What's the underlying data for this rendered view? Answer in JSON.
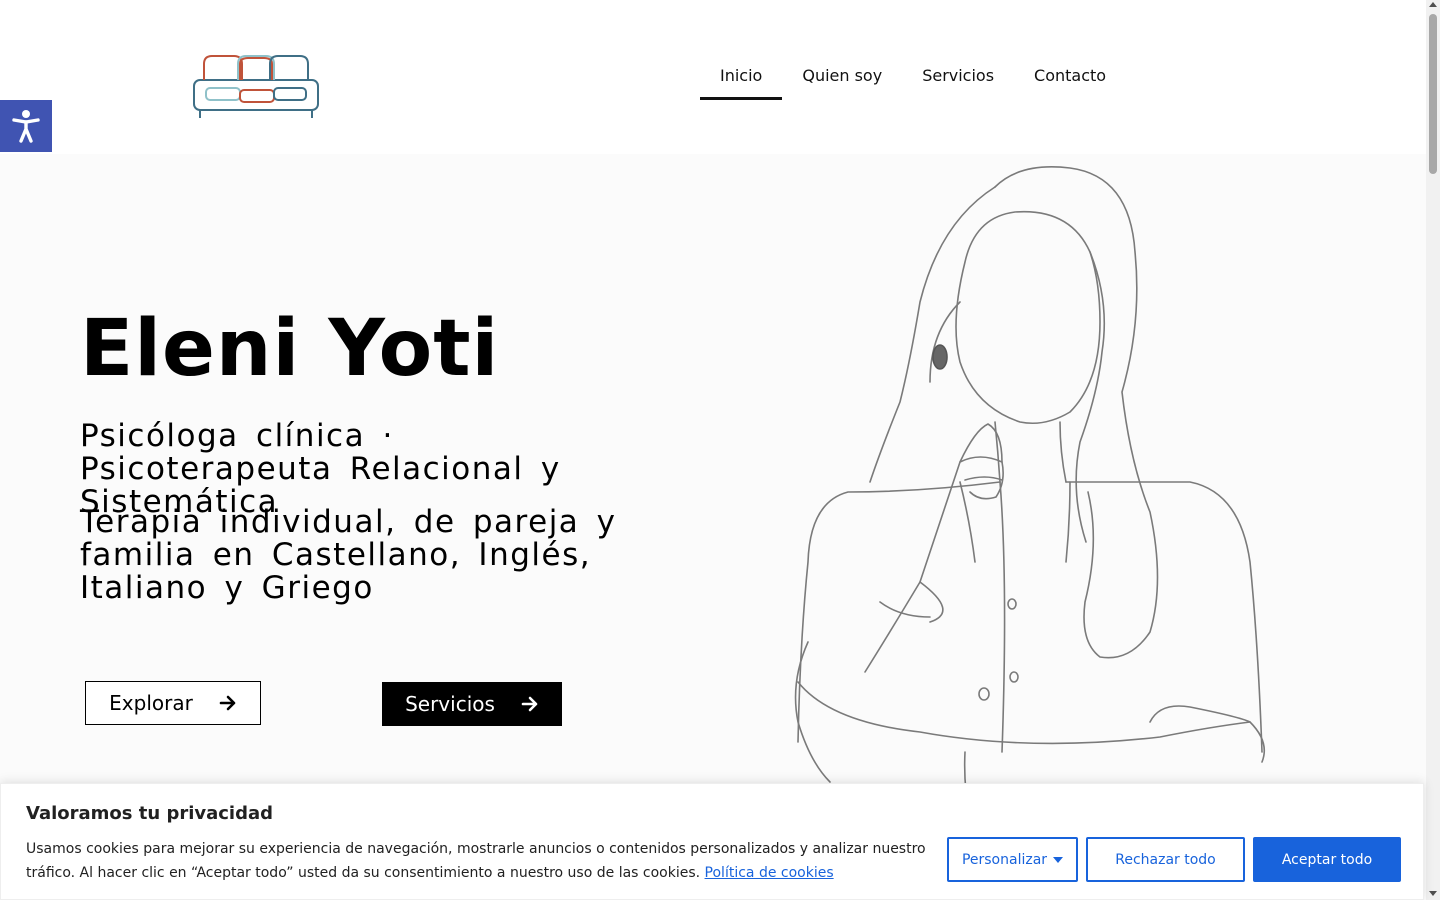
{
  "nav": {
    "items": [
      {
        "label": "Inicio",
        "active": true
      },
      {
        "label": "Quien soy",
        "active": false
      },
      {
        "label": "Servicios",
        "active": false
      },
      {
        "label": "Contacto",
        "active": false
      }
    ]
  },
  "logo": {
    "icon": "sofa-logo-icon",
    "colors": [
      "#c0533a",
      "#3f6f86",
      "#8fc1c9"
    ]
  },
  "accessibility": {
    "icon": "accessibility-person-icon",
    "color": "#4054b2"
  },
  "hero": {
    "name": "Eleni Yoti",
    "role": "Psicóloga clínica · Psicoterapeuta Relacional y Sistemática",
    "description": "Terapia individual, de pareja y familia en Castellano, Inglés, Italiano y Griego",
    "buttons": {
      "explore": "Explorar",
      "services": "Servicios"
    },
    "illustration": "woman-line-drawing"
  },
  "cookie_banner": {
    "title": "Valoramos tu privacidad",
    "text": "Usamos cookies para mejorar su experiencia de navegación, mostrarle anuncios o contenidos personalizados y analizar nuestro tráfico. Al hacer clic en “Aceptar todo” usted da su consentimiento a nuestro uso de las cookies.",
    "link": "Política de cookies",
    "buttons": {
      "customize": "Personalizar",
      "reject": "Rechazar todo",
      "accept": "Aceptar todo"
    },
    "accent_color": "#1863dc"
  }
}
